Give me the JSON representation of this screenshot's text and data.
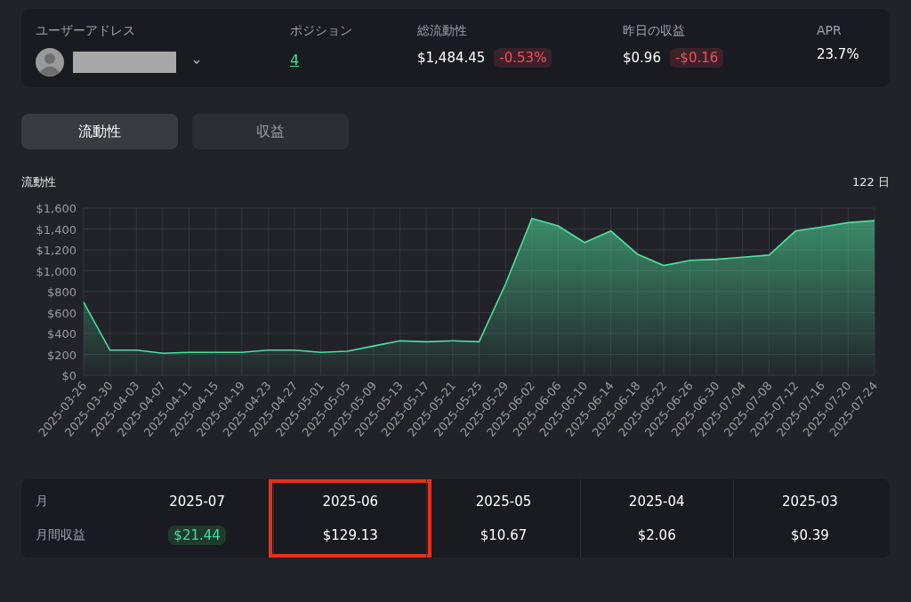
{
  "summary": {
    "address_label": "ユーザーアドレス",
    "position_label": "ポジション",
    "position_value": "4",
    "liquidity_label": "総流動性",
    "liquidity_value": "$1,484.45",
    "liquidity_change": "-0.53%",
    "yesterday_label": "昨日の収益",
    "yesterday_value": "$0.96",
    "yesterday_change": "-$0.16",
    "apr_label": "APR",
    "apr_value": "23.7%"
  },
  "tabs": [
    {
      "label": "流動性",
      "selected": true
    },
    {
      "label": "収益",
      "selected": false
    }
  ],
  "chart": {
    "range": "122 日",
    "chart_data": {
      "type": "area",
      "title": "流動性",
      "grid": true,
      "x": [
        "2025-03-26",
        "2025-03-30",
        "2025-04-03",
        "2025-04-07",
        "2025-04-11",
        "2025-04-15",
        "2025-04-19",
        "2025-04-23",
        "2025-04-27",
        "2025-05-01",
        "2025-05-05",
        "2025-05-09",
        "2025-05-13",
        "2025-05-17",
        "2025-05-21",
        "2025-05-25",
        "2025-05-29",
        "2025-06-02",
        "2025-06-06",
        "2025-06-10",
        "2025-06-14",
        "2025-06-18",
        "2025-06-22",
        "2025-06-26",
        "2025-06-30",
        "2025-07-04",
        "2025-07-08",
        "2025-07-12",
        "2025-07-16",
        "2025-07-20",
        "2025-07-24"
      ],
      "series": [
        {
          "color": "#4ee0a0",
          "values": [
            700,
            240,
            240,
            210,
            220,
            220,
            220,
            240,
            240,
            220,
            230,
            280,
            330,
            320,
            330,
            320,
            870,
            1500,
            1430,
            1270,
            1380,
            1160,
            1050,
            1100,
            1110,
            1130,
            1150,
            1380,
            1420,
            1460,
            1480
          ]
        }
      ],
      "ylim": [
        0,
        1600
      ],
      "yticks": [
        {
          "value": 0,
          "label": "$0"
        },
        {
          "value": 200,
          "label": "$200"
        },
        {
          "value": 400,
          "label": "$400"
        },
        {
          "value": 600,
          "label": "$600"
        },
        {
          "value": 800,
          "label": "$800"
        },
        {
          "value": 1000,
          "label": "$1,000"
        },
        {
          "value": 1200,
          "label": "$1,200"
        },
        {
          "value": 1400,
          "label": "$1,400"
        },
        {
          "value": 1600,
          "label": "$1,600"
        }
      ]
    }
  },
  "monthly": {
    "month_label": "月",
    "earnings_label": "月間収益",
    "months": [
      {
        "month": "2025-07",
        "earnings": "$21.44",
        "kind": "badge",
        "highlighted": false
      },
      {
        "month": "2025-06",
        "earnings": "$129.13",
        "kind": "plain",
        "highlighted": true
      },
      {
        "month": "2025-05",
        "earnings": "$10.67",
        "kind": "plain",
        "highlighted": false
      },
      {
        "month": "2025-04",
        "earnings": "$2.06",
        "kind": "plain",
        "highlighted": false
      },
      {
        "month": "2025-03",
        "earnings": "$0.39",
        "kind": "plain",
        "highlighted": false
      }
    ]
  }
}
